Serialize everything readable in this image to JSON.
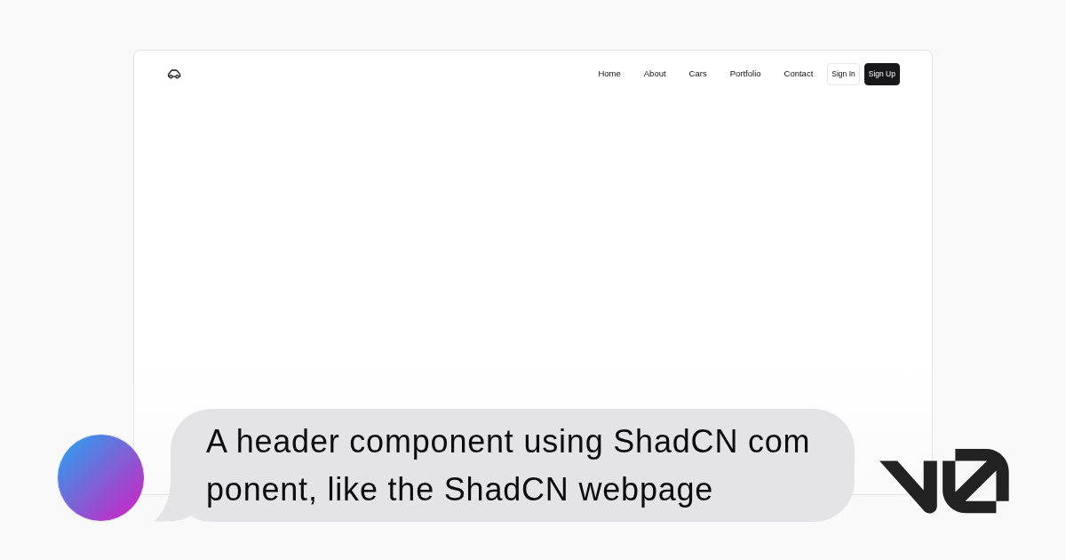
{
  "navbar": {
    "links": [
      "Home",
      "About",
      "Cars",
      "Portfolio",
      "Contact"
    ],
    "buttons": [
      {
        "label": "Sign In",
        "kind": "outline"
      },
      {
        "label": "Sign Up",
        "kind": "solid"
      }
    ]
  },
  "prompt": {
    "lines": [
      "A header component using ShadCN com",
      "ponent, like the ShadCN webpage"
    ]
  }
}
